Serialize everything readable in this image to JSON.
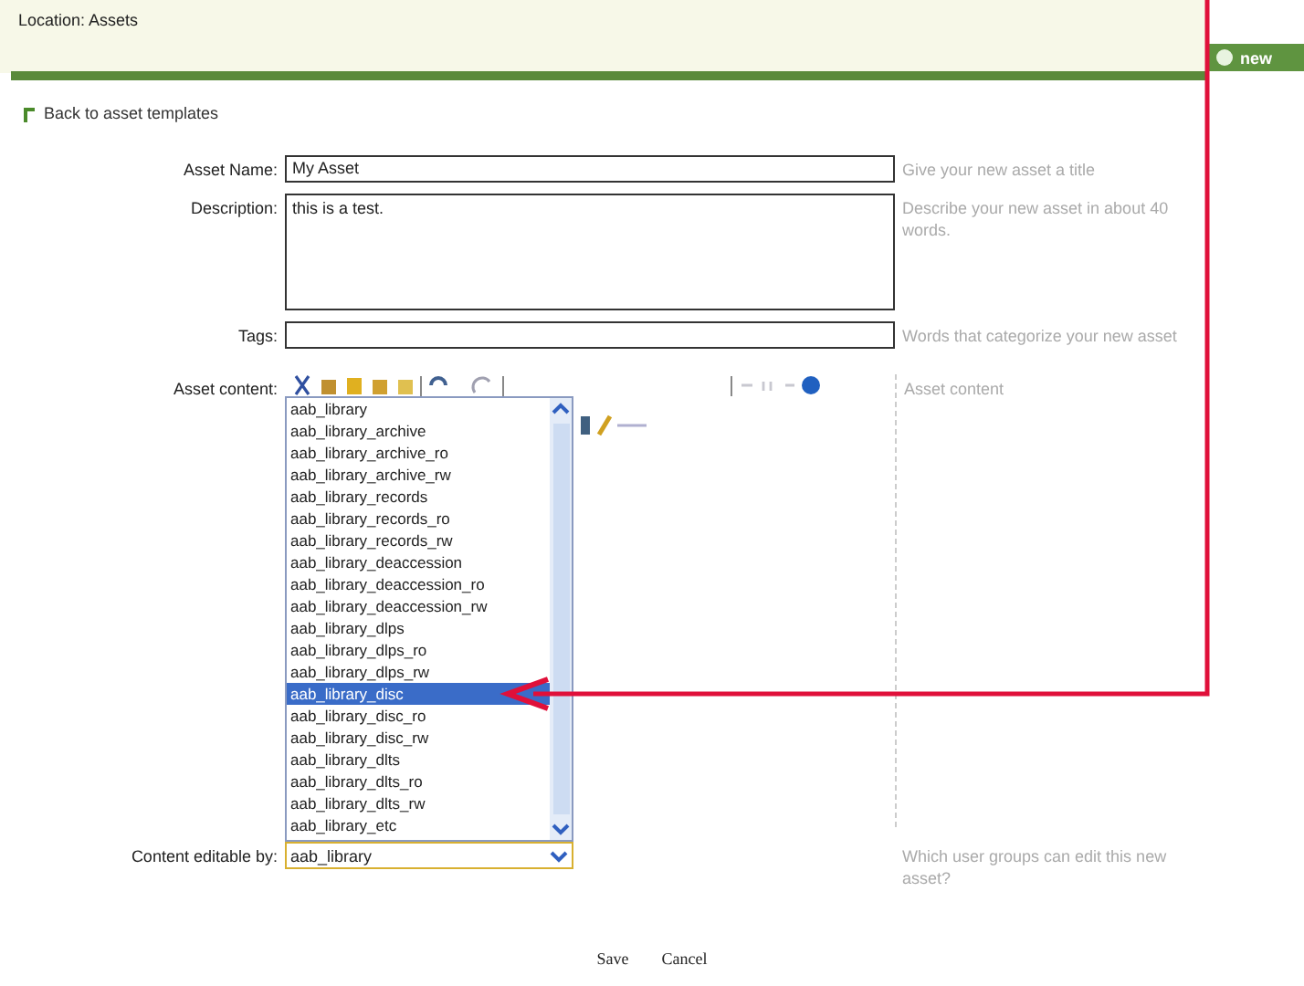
{
  "breadcrumb": "Location: Assets",
  "new_button": "new",
  "back_link": "Back to asset templates",
  "fields": [
    {
      "kind": "input",
      "label": "Asset Name:",
      "value": "My Asset",
      "hint": "Give your new asset a title"
    },
    {
      "kind": "textarea",
      "label": "Description:",
      "value": "this is a test.",
      "hint": "Describe your new asset in about 40 words."
    },
    {
      "kind": "input",
      "label": "Tags:",
      "hint": "Words that categorize your new asset"
    },
    {
      "kind": "editor",
      "label": "Asset content:",
      "hint": "Asset content"
    },
    {
      "kind": "select",
      "label": "Content editable by:",
      "value": "aab_library",
      "hint": "Which user groups can edit this new asset?"
    }
  ],
  "dropdown": {
    "options": [
      {
        "label": "aab_library",
        "selected": false
      },
      {
        "label": "aab_library_archive",
        "selected": false
      },
      {
        "label": "aab_library_archive_ro",
        "selected": false
      },
      {
        "label": "aab_library_archive_rw",
        "selected": false
      },
      {
        "label": "aab_library_records",
        "selected": false
      },
      {
        "label": "aab_library_records_ro",
        "selected": false
      },
      {
        "label": "aab_library_records_rw",
        "selected": false
      },
      {
        "label": "aab_library_deaccession",
        "selected": false
      },
      {
        "label": "aab_library_deaccession_ro",
        "selected": false
      },
      {
        "label": "aab_library_deaccession_rw",
        "selected": false
      },
      {
        "label": "aab_library_dlps",
        "selected": false
      },
      {
        "label": "aab_library_dlps_ro",
        "selected": false
      },
      {
        "label": "aab_library_dlps_rw",
        "selected": false
      },
      {
        "label": "aab_library_disc",
        "selected": true
      },
      {
        "label": "aab_library_disc_ro",
        "selected": false
      },
      {
        "label": "aab_library_disc_rw",
        "selected": false
      },
      {
        "label": "aab_library_dlts",
        "selected": false
      },
      {
        "label": "aab_library_dlts_ro",
        "selected": false
      },
      {
        "label": "aab_library_dlts_rw",
        "selected": false
      },
      {
        "label": "aab_library_etc",
        "selected": false
      }
    ]
  },
  "buttons": [
    "Save",
    "Cancel"
  ]
}
